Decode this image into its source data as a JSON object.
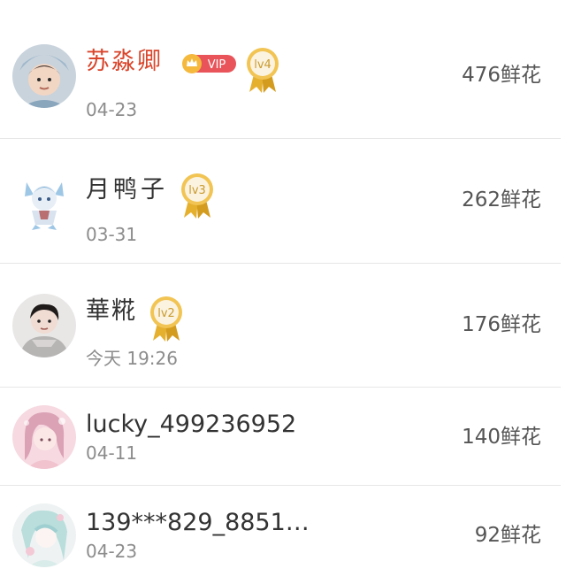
{
  "rows": [
    {
      "name": "苏淼卿",
      "date": "04-23",
      "flowers": "476鲜花",
      "vip": "VIP",
      "level": "lv4"
    },
    {
      "name": "月鸭子",
      "date": "03-31",
      "flowers": "262鲜花",
      "level": "lv3"
    },
    {
      "name": "華糀",
      "date": "今天 19:26",
      "flowers": "176鲜花",
      "level": "lv2"
    },
    {
      "name": "lucky_499236952",
      "date": "04-11",
      "flowers": "140鲜花"
    },
    {
      "name": "139***829_8851…",
      "date": "04-23",
      "flowers": "92鲜花"
    }
  ],
  "colors": {
    "vip_name": "#d9452b",
    "vip_badge": "#e8545a",
    "medal_gold": "#e6b02f",
    "divider": "#e6e6e6"
  }
}
